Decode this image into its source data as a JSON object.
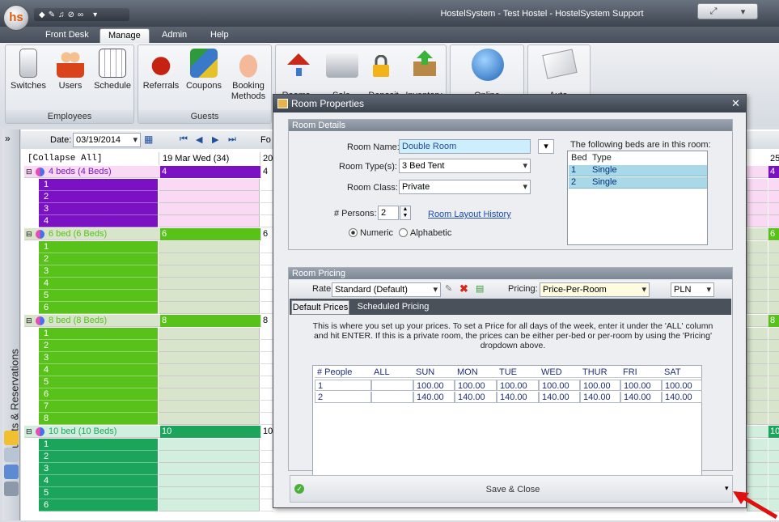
{
  "app": {
    "title": "HostelSystem - Test Hostel - HostelSystem Support",
    "logo": "hs"
  },
  "menu": [
    {
      "label": "Front Desk"
    },
    {
      "label": "Manage",
      "active": true
    },
    {
      "label": "Admin"
    },
    {
      "label": "Help"
    }
  ],
  "ribbon": {
    "employees": {
      "label": "Employees",
      "items": [
        {
          "label": "Switches",
          "icon": "switch-icon"
        },
        {
          "label": "Users",
          "icon": "users-icon"
        },
        {
          "label": "Schedule",
          "icon": "calendar-icon"
        }
      ]
    },
    "guests": {
      "label": "Guests",
      "items": [
        {
          "label": "Referrals",
          "icon": "phone-icon"
        },
        {
          "label": "Coupons",
          "icon": "coupons-icon"
        },
        {
          "label": "Booking Methods",
          "icon": "hand-icon"
        }
      ]
    },
    "more": [
      {
        "label": "Rooms"
      },
      {
        "label": "Sale"
      },
      {
        "label": "Deposit"
      },
      {
        "label": "Inventory"
      },
      {
        "label": "Online"
      },
      {
        "label": "Auto-"
      }
    ]
  },
  "sidebar": {
    "label": "Guests & Reservations"
  },
  "grid": {
    "date_label": "Date:",
    "date_value": "03/19/2014",
    "collapse_label": "[Collapse All]",
    "col_header": "19 Mar Wed (34)",
    "col_header_2": "20",
    "col_header_right": "25",
    "fo_label": "Fo",
    "rooms": [
      {
        "name": "4 beds (4 Beds)",
        "count": "4",
        "color": "#7a12c4",
        "light": "#f9d9f3",
        "beds": [
          "1",
          "2",
          "3",
          "4"
        ]
      },
      {
        "name": "6 bed (6 Beds)",
        "count": "6",
        "color": "#58c21a",
        "light": "#d8e4cc",
        "beds": [
          "1",
          "2",
          "3",
          "4",
          "5",
          "6"
        ]
      },
      {
        "name": "8 bed (8 Beds)",
        "count": "8",
        "color": "#58c21a",
        "light": "#d8e4cc",
        "beds": [
          "1",
          "2",
          "3",
          "4",
          "5",
          "6",
          "7",
          "8"
        ]
      },
      {
        "name": "10 bed (10 Beds)",
        "count": "10",
        "color": "#1aa55a",
        "light": "#d2eede",
        "beds": [
          "1",
          "2",
          "3",
          "4",
          "5",
          "6"
        ]
      }
    ]
  },
  "dialog": {
    "title": "Room Properties",
    "details_title": "Room Details",
    "room_name_label": "Room Name:",
    "room_name": "Double Room",
    "room_type_label": "Room Type(s):",
    "room_type": "3 Bed Tent",
    "room_class_label": "Room Class:",
    "room_class": "Private",
    "persons_label": "# Persons:",
    "persons": "2",
    "layout_history_link": "Room Layout History",
    "radio_numeric": "Numeric",
    "radio_alphabetic": "Alphabetic",
    "beds_caption": "The following beds are in this room:",
    "beds_headers": [
      "Bed",
      "Type"
    ],
    "beds": [
      {
        "bed": "1",
        "type": "Single"
      },
      {
        "bed": "2",
        "type": "Single"
      }
    ],
    "pricing_title": "Room Pricing",
    "rate_label": "Rate:",
    "rate": "Standard (Default)",
    "pricing_label": "Pricing:",
    "pricing": "Price-Per-Room",
    "currency": "PLN",
    "tabs": [
      {
        "label": "Default Prices",
        "active": true
      },
      {
        "label": "Scheduled Pricing"
      }
    ],
    "help_text": "This is where you set up your prices.  To set a Price for all days of the week, enter it under the 'ALL' column and hit ENTER.  If this is a private room, the prices can be either per-bed or per-room by using the 'Pricing' dropdown above.",
    "price_headers": [
      "# People",
      "ALL",
      "SUN",
      "MON",
      "TUE",
      "WED",
      "THUR",
      "FRI",
      "SAT"
    ],
    "price_rows": [
      [
        "1",
        "",
        "100.00",
        "100.00",
        "100.00",
        "100.00",
        "100.00",
        "100.00",
        "100.00"
      ],
      [
        "2",
        "",
        "140.00",
        "140.00",
        "140.00",
        "140.00",
        "140.00",
        "140.00",
        "140.00"
      ]
    ],
    "save_close": "Save & Close"
  }
}
